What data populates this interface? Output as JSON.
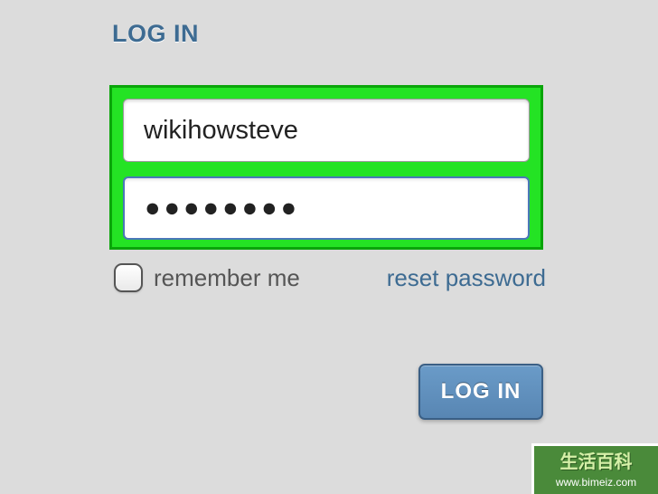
{
  "header": {
    "title": "LOG IN"
  },
  "form": {
    "username_value": "wikihowsteve",
    "password_masked": "●●●●●●●●",
    "remember_label": "remember me",
    "reset_link": "reset password",
    "submit_label": "LOG IN"
  },
  "watermark": {
    "text_cn": "生活百科",
    "url": "www.bimeiz.com"
  }
}
